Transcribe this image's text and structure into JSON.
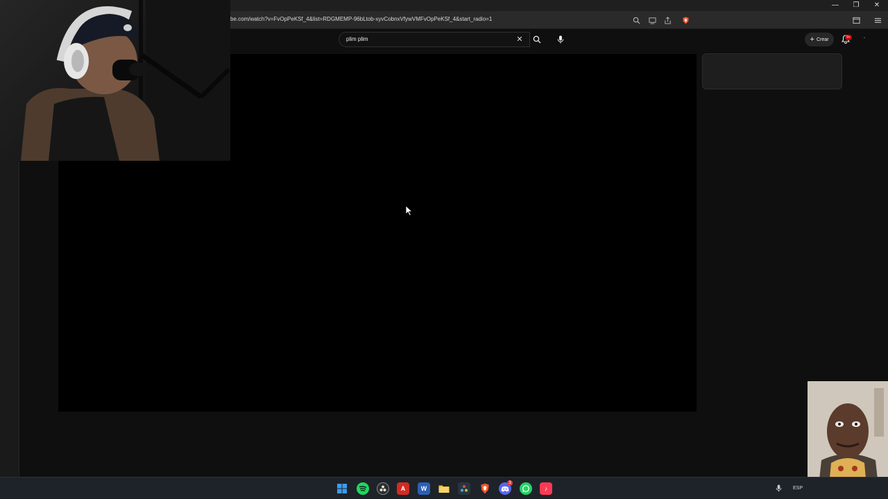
{
  "browser": {
    "url": "be.com/watch?v=FvOpPeKSf_4&list=RDGMEMP-96bLtob-xyvCobnxVfywVMFvOpPeKSf_4&start_radio=1",
    "window_controls": {
      "minimize": "—",
      "restore": "❐",
      "close": "✕"
    }
  },
  "youtube": {
    "search": {
      "query": "plim plim",
      "clear_icon": "✕"
    },
    "create_label": "Crear",
    "notification_badge": "9+"
  },
  "taskbar": {
    "apps": [
      "windows-start",
      "spotify",
      "obs",
      "acrobat",
      "word",
      "file-explorer",
      "davinci-resolve",
      "brave",
      "discord",
      "whatsapp",
      "apple-music"
    ],
    "discord_badge": "3",
    "tray": {
      "language": "ESP"
    }
  },
  "colors": {
    "page_bg": "#0f0f0f",
    "player_bg": "#000000",
    "taskbar_bg": "#1e2329",
    "brave_orange": "#fb542b",
    "spotify_green": "#1ed760",
    "youtube_red": "#cc0000"
  }
}
